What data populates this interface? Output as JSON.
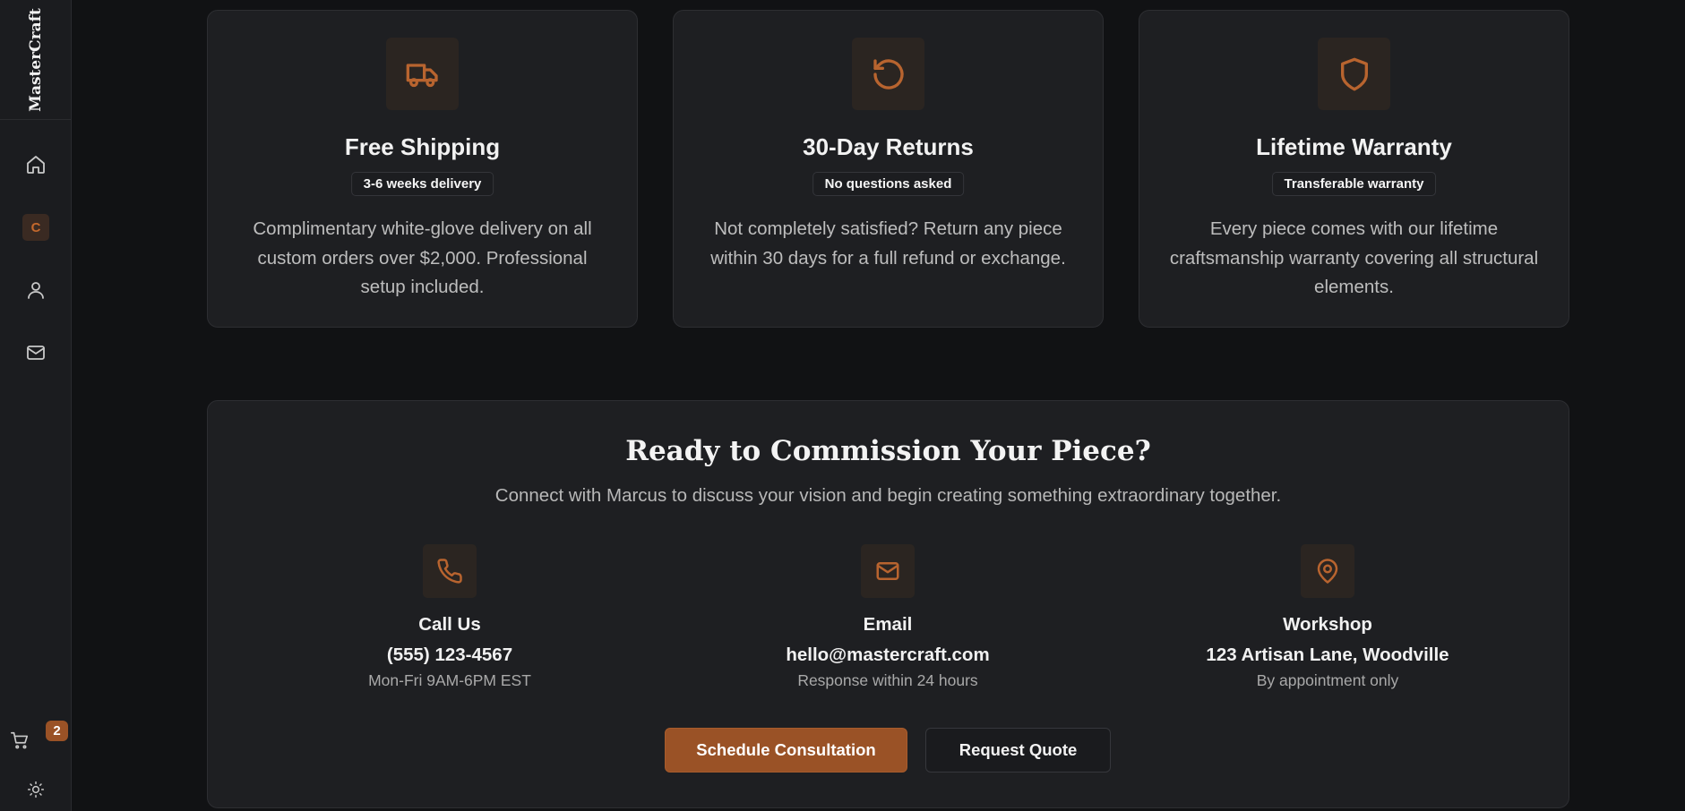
{
  "sidebar": {
    "brand": "MasterCraft",
    "nav": [
      {
        "icon": "home-icon"
      },
      {
        "icon": "c-badge-icon",
        "label": "C"
      },
      {
        "icon": "user-icon"
      },
      {
        "icon": "mail-icon"
      }
    ],
    "cart_count": "2"
  },
  "features": [
    {
      "icon": "truck-icon",
      "title": "Free Shipping",
      "tag": "3-6 weeks delivery",
      "text": "Complimentary white-glove delivery on all custom orders over $2,000. Professional setup included."
    },
    {
      "icon": "rotate-ccw-icon",
      "title": "30-Day Returns",
      "tag": "No questions asked",
      "text": "Not completely satisfied? Return any piece within 30 days for a full refund or exchange."
    },
    {
      "icon": "shield-icon",
      "title": "Lifetime Warranty",
      "tag": "Transferable warranty",
      "text": "Every piece comes with our lifetime craftsmanship warranty covering all structural elements."
    }
  ],
  "cta": {
    "title": "Ready to Commission Your Piece?",
    "subtitle": "Connect with Marcus to discuss your vision and begin creating something extraordinary together.",
    "contacts": [
      {
        "icon": "phone-icon",
        "label": "Call Us",
        "value": "(555) 123-4567",
        "note": "Mon-Fri 9AM-6PM EST"
      },
      {
        "icon": "mail-icon",
        "label": "Email",
        "value": "hello@mastercraft.com",
        "note": "Response within 24 hours"
      },
      {
        "icon": "map-pin-icon",
        "label": "Workshop",
        "value": "123 Artisan Lane, Woodville",
        "note": "By appointment only"
      }
    ],
    "primary_button": "Schedule Consultation",
    "secondary_button": "Request Quote"
  },
  "colors": {
    "accent": "#9a5226",
    "icon_accent": "#b8642f",
    "background": "#111214",
    "card": "#1e1f22"
  }
}
